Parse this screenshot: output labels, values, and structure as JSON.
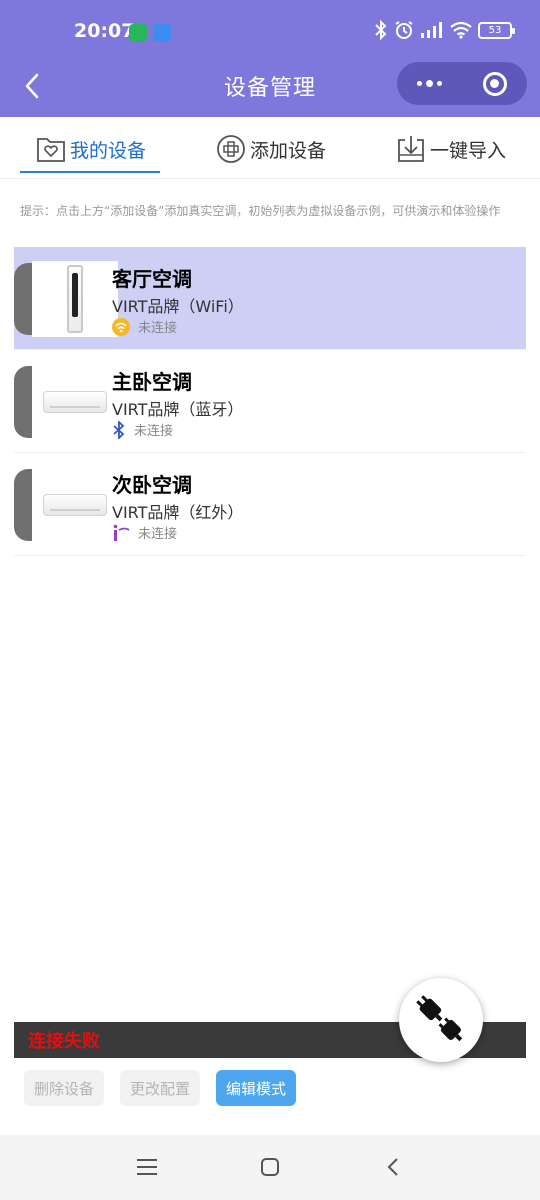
{
  "status_bar": {
    "time": "20:07",
    "battery": "53",
    "icons": [
      "bluetooth-icon",
      "alarm-icon",
      "signal-icon",
      "wifi-icon",
      "battery-icon"
    ]
  },
  "header": {
    "title": "设备管理",
    "color": "#7e78dc"
  },
  "tabs": [
    {
      "label": "我的设备",
      "icon": "device-folder-icon",
      "active": true
    },
    {
      "label": "添加设备",
      "icon": "add-circle-icon",
      "active": false
    },
    {
      "label": "一键导入",
      "icon": "import-icon",
      "active": false
    }
  ],
  "hint": "提示：点击上方“添加设备”添加真实空调，初始列表为虚拟设备示例，可供演示和体验操作",
  "devices": [
    {
      "name": "客厅空调",
      "brand": "VIRT品牌（WiFi）",
      "status": "未连接",
      "connection_icon": "wifi-badge-icon",
      "selected": true
    },
    {
      "name": "主卧空调",
      "brand": "VIRT品牌（蓝牙）",
      "status": "未连接",
      "connection_icon": "bluetooth-icon",
      "selected": false
    },
    {
      "name": "次卧空调",
      "brand": "VIRT品牌（红外）",
      "status": "未连接",
      "connection_icon": "infrared-icon",
      "selected": false
    }
  ],
  "connection_bar": {
    "text": "连接失败"
  },
  "actions": {
    "delete_label": "删除设备",
    "config_label": "更改配置",
    "edit_label": "编辑模式"
  },
  "fab": {
    "icon": "plug-disconnected-icon"
  },
  "colors": {
    "accent": "#1a6fcf",
    "selected_row": "#cdd0f4",
    "error": "#e01010",
    "primary_button": "#4ea6ee"
  }
}
